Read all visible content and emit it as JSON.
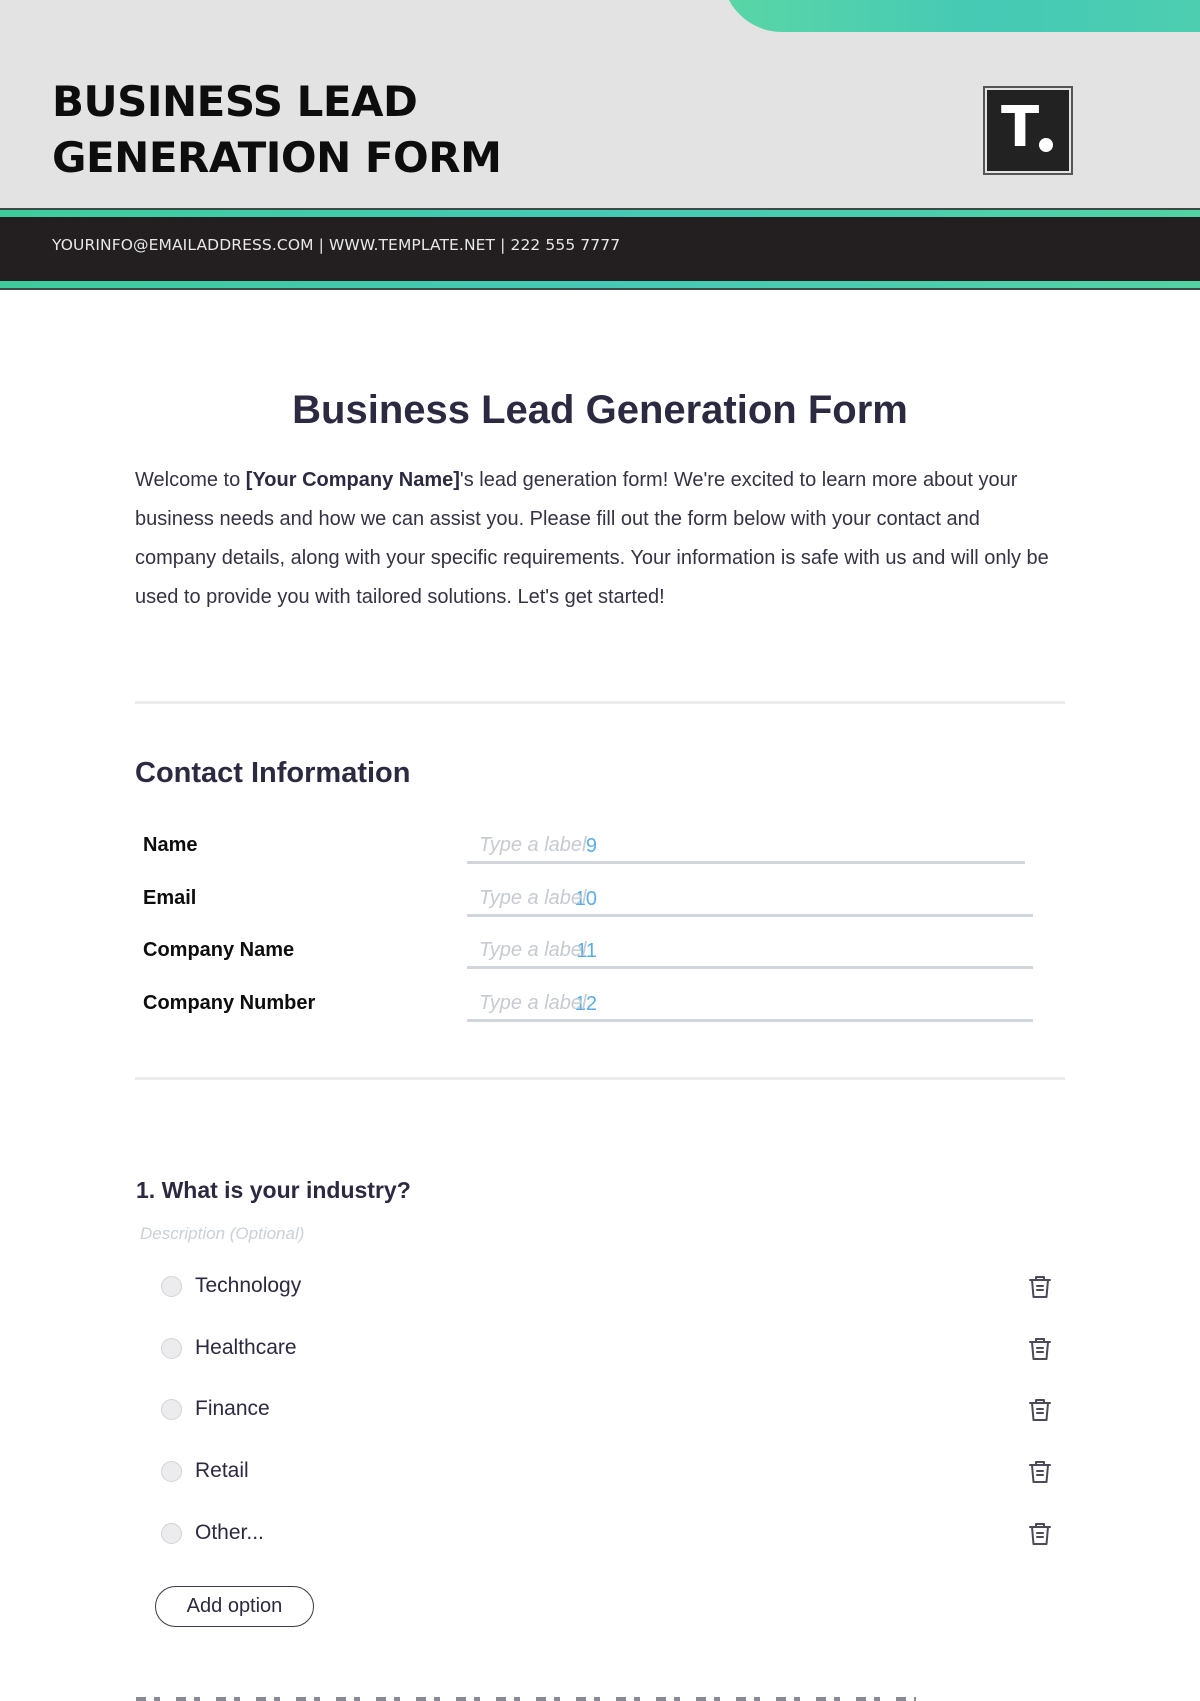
{
  "header": {
    "title_line1": "BUSINESS LEAD",
    "title_line2": "GENERATION FORM",
    "logo_letter": "T",
    "contact_line": "YOURINFO@EMAILADDRESS.COM | WWW.TEMPLATE.NET | 222 555 7777",
    "colors": {
      "accent": "#45c9b5",
      "band": "#231f20",
      "header_bg": "#e3e3e3"
    }
  },
  "form": {
    "title": "Business Lead Generation Form",
    "intro": {
      "prefix": "Welcome to ",
      "company_placeholder": "[Your Company Name]",
      "suffix": "'s lead generation form! We're excited to learn more about your business needs and how we can assist you. Please fill out the form below with your contact and company details, along with your specific requirements. Your information is safe with us and will only be used to provide you with tailored solutions. Let's get started!"
    },
    "contact_section": {
      "title": "Contact Information",
      "fields": [
        {
          "label": "Name",
          "number": "9",
          "placeholder": "Type a label",
          "value": ""
        },
        {
          "label": "Email",
          "number": "10",
          "placeholder": "Type a label",
          "value": ""
        },
        {
          "label": "Company Name",
          "number": "11",
          "placeholder": "Type a label",
          "value": ""
        },
        {
          "label": "Company Number",
          "number": "12",
          "placeholder": "Type a label",
          "value": ""
        }
      ]
    },
    "questions": [
      {
        "title": "1. What is your industry?",
        "description_placeholder": "Description (Optional)",
        "options": [
          {
            "label": "Technology",
            "selected": false
          },
          {
            "label": "Healthcare",
            "selected": false
          },
          {
            "label": "Finance",
            "selected": false
          },
          {
            "label": "Retail",
            "selected": false
          },
          {
            "label": "Other...",
            "selected": false
          }
        ],
        "add_option_label": "Add option",
        "delete_icon": "trash-icon"
      }
    ],
    "colors": {
      "heading": "#2b2a40",
      "field_number": "#5aaee8",
      "placeholder": "#c6cbd2"
    }
  }
}
